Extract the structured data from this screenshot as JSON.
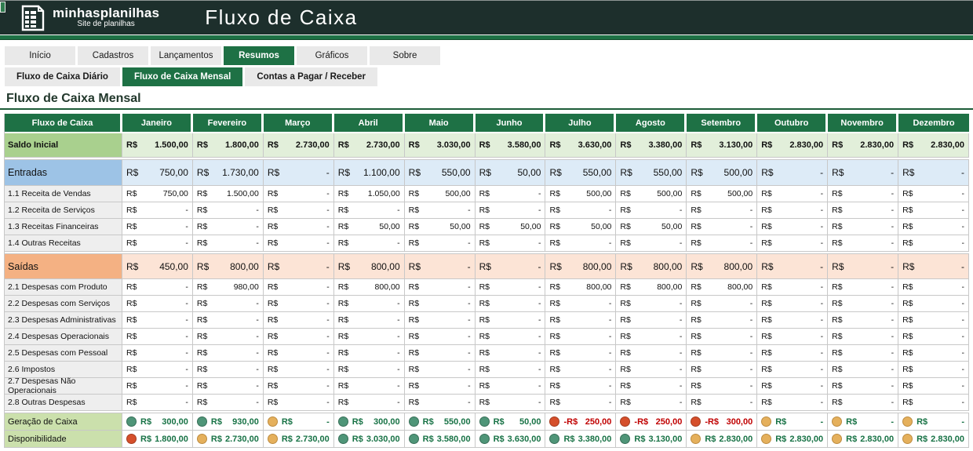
{
  "brand": {
    "name": "minhasplanilhas",
    "tagline": "Site de planilhas",
    "app_title": "Fluxo de Caixa"
  },
  "nav_tabs": [
    {
      "label": "Início",
      "active": false
    },
    {
      "label": "Cadastros",
      "active": false
    },
    {
      "label": "Lançamentos",
      "active": false
    },
    {
      "label": "Resumos",
      "active": true
    },
    {
      "label": "Gráficos",
      "active": false
    },
    {
      "label": "Sobre",
      "active": false
    }
  ],
  "sub_tabs": [
    {
      "label": "Fluxo de Caixa Diário",
      "active": false
    },
    {
      "label": "Fluxo de Caixa Mensal",
      "active": true
    },
    {
      "label": "Contas a Pagar / Receber",
      "active": false
    }
  ],
  "page_title": "Fluxo de Caixa Mensal",
  "table": {
    "corner_header": "Fluxo de Caixa",
    "months": [
      "Janeiro",
      "Fevereiro",
      "Março",
      "Abril",
      "Maio",
      "Junho",
      "Julho",
      "Agosto",
      "Setembro",
      "Outubro",
      "Novembro",
      "Dezembro"
    ],
    "currency_symbol": "R$",
    "rows": [
      {
        "kind": "saldo",
        "label": "Saldo Inicial",
        "values": [
          "1.500,00",
          "1.800,00",
          "2.730,00",
          "2.730,00",
          "3.030,00",
          "3.580,00",
          "3.630,00",
          "3.380,00",
          "3.130,00",
          "2.830,00",
          "2.830,00",
          "2.830,00"
        ]
      },
      {
        "kind": "section_blue",
        "label": "Entradas",
        "values": [
          "750,00",
          "1.730,00",
          "-",
          "1.100,00",
          "550,00",
          "50,00",
          "550,00",
          "550,00",
          "500,00",
          "-",
          "-",
          "-"
        ]
      },
      {
        "kind": "detail",
        "label": "1.1 Receita de Vendas",
        "values": [
          "750,00",
          "1.500,00",
          "-",
          "1.050,00",
          "500,00",
          "-",
          "500,00",
          "500,00",
          "500,00",
          "-",
          "-",
          "-"
        ]
      },
      {
        "kind": "detail",
        "label": "1.2 Receita de Serviços",
        "values": [
          "-",
          "-",
          "-",
          "-",
          "-",
          "-",
          "-",
          "-",
          "-",
          "-",
          "-",
          "-"
        ]
      },
      {
        "kind": "detail",
        "label": "1.3 Receitas Financeiras",
        "values": [
          "-",
          "-",
          "-",
          "50,00",
          "50,00",
          "50,00",
          "50,00",
          "50,00",
          "-",
          "-",
          "-",
          "-"
        ]
      },
      {
        "kind": "detail",
        "label": "1.4 Outras Receitas",
        "values": [
          "-",
          "-",
          "-",
          "-",
          "-",
          "-",
          "-",
          "-",
          "-",
          "-",
          "-",
          "-"
        ]
      },
      {
        "kind": "section_orange",
        "label": "Saídas",
        "values": [
          "450,00",
          "800,00",
          "-",
          "800,00",
          "-",
          "-",
          "800,00",
          "800,00",
          "800,00",
          "-",
          "-",
          "-"
        ]
      },
      {
        "kind": "detail",
        "label": "2.1 Despesas com Produto",
        "values": [
          "-",
          "980,00",
          "-",
          "800,00",
          "-",
          "-",
          "800,00",
          "800,00",
          "800,00",
          "-",
          "-",
          "-"
        ]
      },
      {
        "kind": "detail",
        "label": "2.2 Despesas com Serviços",
        "values": [
          "-",
          "-",
          "-",
          "-",
          "-",
          "-",
          "-",
          "-",
          "-",
          "-",
          "-",
          "-"
        ]
      },
      {
        "kind": "detail",
        "label": "2.3 Despesas Administrativas",
        "values": [
          "-",
          "-",
          "-",
          "-",
          "-",
          "-",
          "-",
          "-",
          "-",
          "-",
          "-",
          "-"
        ]
      },
      {
        "kind": "detail",
        "label": "2.4 Despesas Operacionais",
        "values": [
          "-",
          "-",
          "-",
          "-",
          "-",
          "-",
          "-",
          "-",
          "-",
          "-",
          "-",
          "-"
        ]
      },
      {
        "kind": "detail",
        "label": "2.5 Despesas com Pessoal",
        "values": [
          "-",
          "-",
          "-",
          "-",
          "-",
          "-",
          "-",
          "-",
          "-",
          "-",
          "-",
          "-"
        ]
      },
      {
        "kind": "detail",
        "label": "2.6 Impostos",
        "values": [
          "-",
          "-",
          "-",
          "-",
          "-",
          "-",
          "-",
          "-",
          "-",
          "-",
          "-",
          "-"
        ]
      },
      {
        "kind": "detail",
        "label": "2.7 Despesas Não Operacionais",
        "values": [
          "-",
          "-",
          "-",
          "-",
          "-",
          "-",
          "-",
          "-",
          "-",
          "-",
          "-",
          "-"
        ]
      },
      {
        "kind": "detail",
        "label": "2.8 Outras Despesas",
        "values": [
          "-",
          "-",
          "-",
          "-",
          "-",
          "-",
          "-",
          "-",
          "-",
          "-",
          "-",
          "-"
        ]
      },
      {
        "kind": "indicator",
        "label": "Geração de Caixa",
        "cells": [
          {
            "dot": "green",
            "prefix": "R$",
            "amount": "300,00",
            "neg": false
          },
          {
            "dot": "green",
            "prefix": "R$",
            "amount": "930,00",
            "neg": false
          },
          {
            "dot": "amber",
            "prefix": "R$",
            "amount": "-",
            "neg": false
          },
          {
            "dot": "green",
            "prefix": "R$",
            "amount": "300,00",
            "neg": false
          },
          {
            "dot": "green",
            "prefix": "R$",
            "amount": "550,00",
            "neg": false
          },
          {
            "dot": "green",
            "prefix": "R$",
            "amount": "50,00",
            "neg": false
          },
          {
            "dot": "red",
            "prefix": "-R$",
            "amount": "250,00",
            "neg": true
          },
          {
            "dot": "red",
            "prefix": "-R$",
            "amount": "250,00",
            "neg": true
          },
          {
            "dot": "red",
            "prefix": "-R$",
            "amount": "300,00",
            "neg": true
          },
          {
            "dot": "amber",
            "prefix": "R$",
            "amount": "-",
            "neg": false
          },
          {
            "dot": "amber",
            "prefix": "R$",
            "amount": "-",
            "neg": false
          },
          {
            "dot": "amber",
            "prefix": "R$",
            "amount": "-",
            "neg": false
          }
        ]
      },
      {
        "kind": "indicator",
        "label": "Disponibilidade",
        "cells": [
          {
            "dot": "red",
            "prefix": "R$",
            "amount": "1.800,00",
            "neg": false
          },
          {
            "dot": "amber",
            "prefix": "R$",
            "amount": "2.730,00",
            "neg": false
          },
          {
            "dot": "amber",
            "prefix": "R$",
            "amount": "2.730,00",
            "neg": false
          },
          {
            "dot": "green",
            "prefix": "R$",
            "amount": "3.030,00",
            "neg": false
          },
          {
            "dot": "green",
            "prefix": "R$",
            "amount": "3.580,00",
            "neg": false
          },
          {
            "dot": "green",
            "prefix": "R$",
            "amount": "3.630,00",
            "neg": false
          },
          {
            "dot": "green",
            "prefix": "R$",
            "amount": "3.380,00",
            "neg": false
          },
          {
            "dot": "green",
            "prefix": "R$",
            "amount": "3.130,00",
            "neg": false
          },
          {
            "dot": "amber",
            "prefix": "R$",
            "amount": "2.830,00",
            "neg": false
          },
          {
            "dot": "amber",
            "prefix": "R$",
            "amount": "2.830,00",
            "neg": false
          },
          {
            "dot": "amber",
            "prefix": "R$",
            "amount": "2.830,00",
            "neg": false
          },
          {
            "dot": "amber",
            "prefix": "R$",
            "amount": "2.830,00",
            "neg": false
          }
        ]
      }
    ]
  },
  "colors": {
    "topbar": "#1d2f2c",
    "accent_green": "#1e7145",
    "saldo_label": "#a9d08e",
    "entradas_label": "#9dc3e6",
    "saidas_label": "#f4b183",
    "indicator_label": "#cbe0ac",
    "positive_text": "#177245",
    "negative_text": "#c00000",
    "dot_green": "#4f9578",
    "dot_amber": "#e5b05c",
    "dot_red": "#d54f2b"
  }
}
